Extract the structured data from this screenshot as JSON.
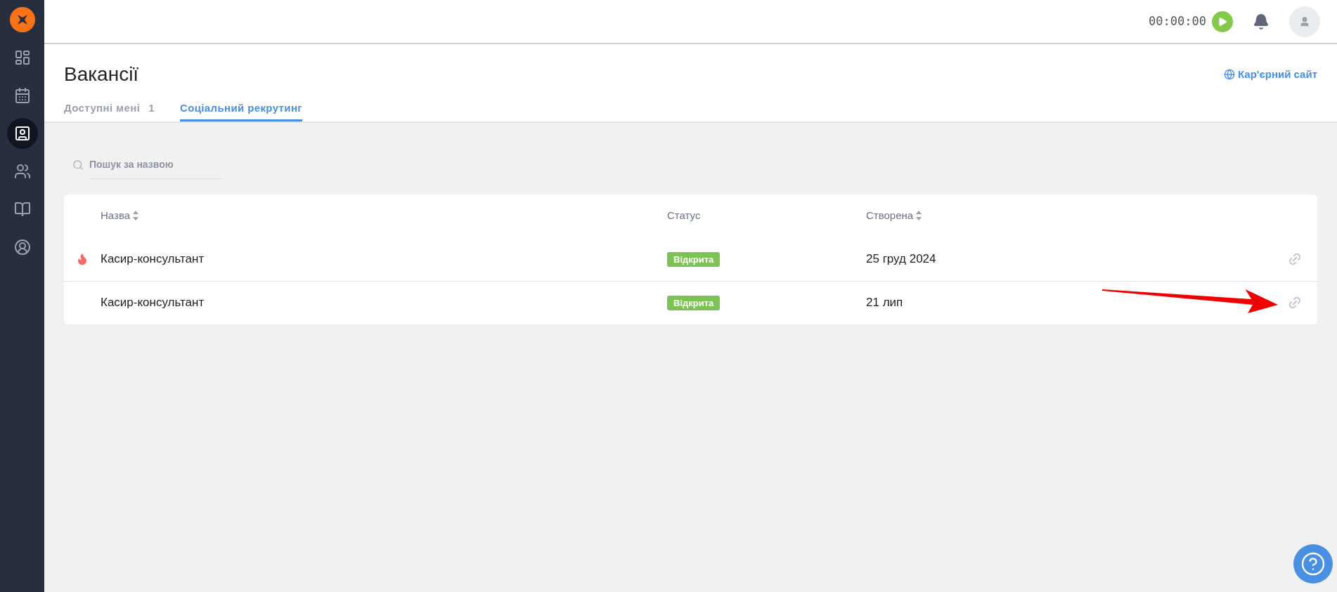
{
  "sidebar": {
    "items": [
      {
        "kind": "dashboard",
        "selected": false
      },
      {
        "kind": "calendar",
        "selected": false
      },
      {
        "kind": "vacancies",
        "selected": true
      },
      {
        "kind": "team",
        "selected": false
      },
      {
        "kind": "book",
        "selected": false
      },
      {
        "kind": "profile",
        "selected": false
      }
    ]
  },
  "topbar": {
    "timer": "00:00:00"
  },
  "page": {
    "title": "Вакансії",
    "career_link": "Кар'єрний сайт"
  },
  "tabs": [
    {
      "label": "Доступні мені",
      "count": "1",
      "selected": false
    },
    {
      "label": "Соціальний рекрутинг",
      "selected": true
    }
  ],
  "search": {
    "placeholder": "Пошук за назвою"
  },
  "table": {
    "columns": [
      {
        "label": "Назва",
        "sortable": true
      },
      {
        "label": "Статус",
        "sortable": false
      },
      {
        "label": "Створена",
        "sortable": true
      }
    ],
    "rows": [
      {
        "hot": true,
        "name": "Касир-консультант",
        "status": "Відкрита",
        "created": "25 груд 2024"
      },
      {
        "hot": false,
        "name": "Касир-консультант",
        "status": "Відкрита",
        "created": "21 лип"
      }
    ]
  }
}
